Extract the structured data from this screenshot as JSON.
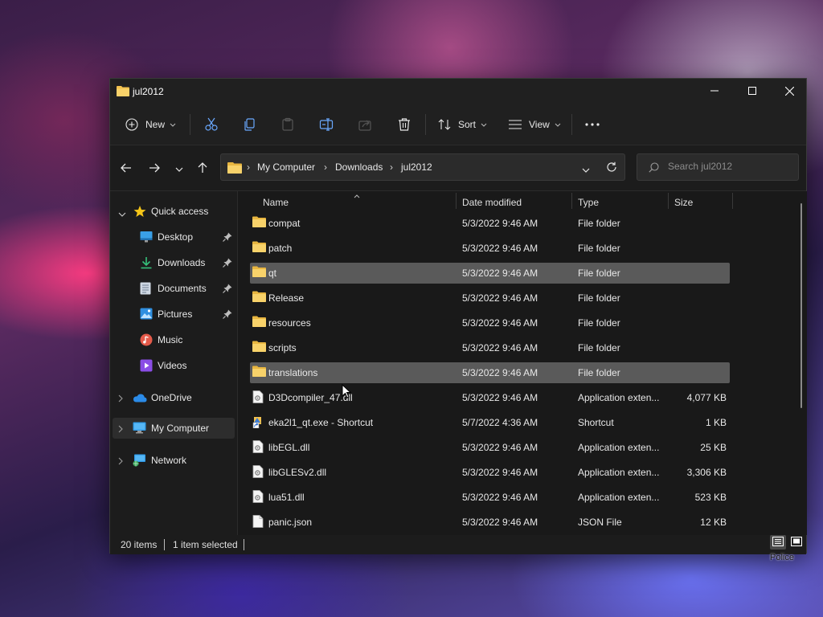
{
  "window": {
    "title": "jul2012"
  },
  "toolbar": {
    "new_label": "New",
    "sort_label": "Sort",
    "view_label": "View",
    "icons": [
      "new-icon",
      "cut-icon",
      "copy-icon",
      "paste-icon",
      "rename-icon",
      "share-icon",
      "delete-icon",
      "sort-icon",
      "view-icon",
      "more-icon"
    ]
  },
  "address": {
    "crumbs": [
      "My Computer",
      "Downloads",
      "jul2012"
    ]
  },
  "search": {
    "placeholder": "Search jul2012"
  },
  "sidebar": {
    "quick_access": "Quick access",
    "items": [
      {
        "label": "Desktop",
        "icon": "desktop-icon",
        "pinned": true
      },
      {
        "label": "Downloads",
        "icon": "downloads-icon",
        "pinned": true
      },
      {
        "label": "Documents",
        "icon": "documents-icon",
        "pinned": true
      },
      {
        "label": "Pictures",
        "icon": "pictures-icon",
        "pinned": true
      },
      {
        "label": "Music",
        "icon": "music-icon",
        "pinned": false
      },
      {
        "label": "Videos",
        "icon": "videos-icon",
        "pinned": false
      }
    ],
    "onedrive": "OneDrive",
    "my_computer": "My Computer",
    "network": "Network"
  },
  "columns": {
    "name": "Name",
    "date": "Date modified",
    "type": "Type",
    "size": "Size"
  },
  "files": [
    {
      "name": "compat",
      "date": "5/3/2022 9:46 AM",
      "type": "File folder",
      "size": "",
      "icon": "folder"
    },
    {
      "name": "patch",
      "date": "5/3/2022 9:46 AM",
      "type": "File folder",
      "size": "",
      "icon": "folder"
    },
    {
      "name": "qt",
      "date": "5/3/2022 9:46 AM",
      "type": "File folder",
      "size": "",
      "icon": "folder"
    },
    {
      "name": "Release",
      "date": "5/3/2022 9:46 AM",
      "type": "File folder",
      "size": "",
      "icon": "folder"
    },
    {
      "name": "resources",
      "date": "5/3/2022 9:46 AM",
      "type": "File folder",
      "size": "",
      "icon": "folder"
    },
    {
      "name": "scripts",
      "date": "5/3/2022 9:46 AM",
      "type": "File folder",
      "size": "",
      "icon": "folder"
    },
    {
      "name": "translations",
      "date": "5/3/2022 9:46 AM",
      "type": "File folder",
      "size": "",
      "icon": "folder"
    },
    {
      "name": "D3Dcompiler_47.dll",
      "date": "5/3/2022 9:46 AM",
      "type": "Application exten...",
      "size": "4,077 KB",
      "icon": "dll"
    },
    {
      "name": "eka2l1_qt.exe - Shortcut",
      "date": "5/7/2022 4:36 AM",
      "type": "Shortcut",
      "size": "1 KB",
      "icon": "shortcut"
    },
    {
      "name": "libEGL.dll",
      "date": "5/3/2022 9:46 AM",
      "type": "Application exten...",
      "size": "25 KB",
      "icon": "dll"
    },
    {
      "name": "libGLESv2.dll",
      "date": "5/3/2022 9:46 AM",
      "type": "Application exten...",
      "size": "3,306 KB",
      "icon": "dll"
    },
    {
      "name": "lua51.dll",
      "date": "5/3/2022 9:46 AM",
      "type": "Application exten...",
      "size": "523 KB",
      "icon": "dll"
    },
    {
      "name": "panic.json",
      "date": "5/3/2022 9:46 AM",
      "type": "JSON File",
      "size": "12 KB",
      "icon": "file"
    }
  ],
  "highlighted_rows": [
    2,
    6
  ],
  "status": {
    "items": "20 items",
    "selected": "1 item selected"
  },
  "tooltip": "Police",
  "colors": {
    "folder": "#f2c14e",
    "selection": "#5a5a5a",
    "window_bg": "#1c1c1c"
  }
}
